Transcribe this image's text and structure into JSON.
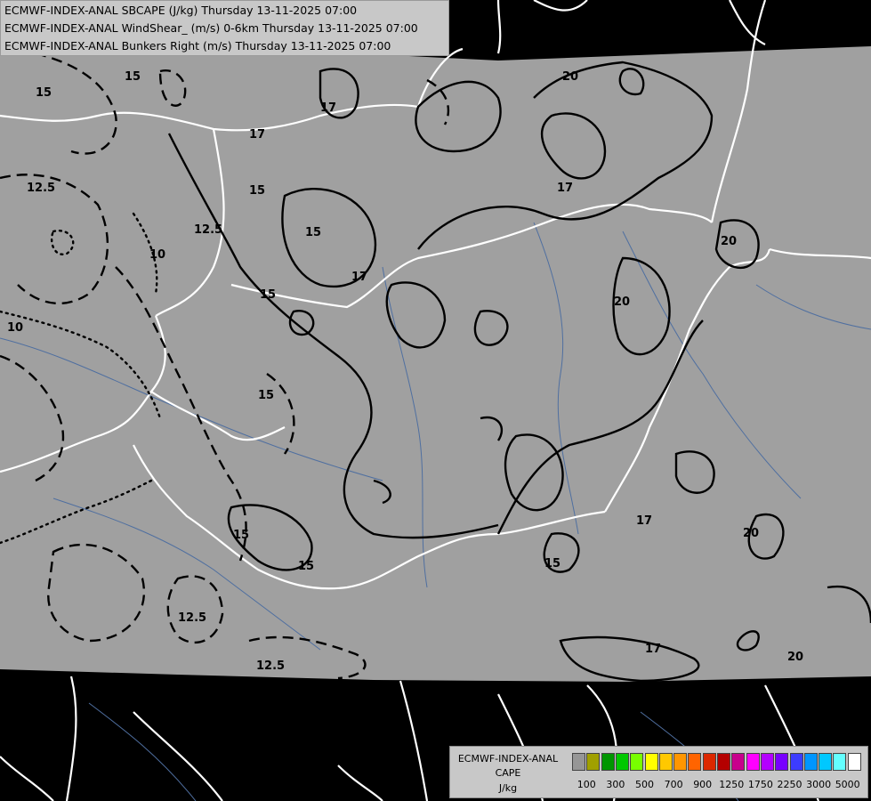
{
  "header": {
    "line1": "ECMWF-INDEX-ANAL SBCAPE (J/kg) Thursday 13-11-2025 07:00",
    "line2": "ECMWF-INDEX-ANAL WindShear_ (m/s) 0-6km Thursday 13-11-2025 07:00",
    "line3": "ECMWF-INDEX-ANAL Bunkers Right (m/s) Thursday 13-11-2025 07:00"
  },
  "legend": {
    "title1": "ECMWF-INDEX-ANAL",
    "title2": "CAPE",
    "unit": "J/kg",
    "ticks": [
      "100",
      "300",
      "500",
      "700",
      "900",
      "1250",
      "1750",
      "2250",
      "3000",
      "5000"
    ],
    "colors": [
      "#969696",
      "#a0a000",
      "#009600",
      "#00c800",
      "#78ff00",
      "#ffff00",
      "#ffc800",
      "#ff9600",
      "#ff6400",
      "#dc2800",
      "#b40000",
      "#c8008c",
      "#ff00ff",
      "#b400ff",
      "#7800ff",
      "#3c3cff",
      "#0096ff",
      "#00c8ff",
      "#64ffff",
      "#ffffff"
    ]
  },
  "map": {
    "background_color": "#000000",
    "domain_fill": "#a0a0a0",
    "contour_labels": {
      "shear_solid": [
        "15",
        "15",
        "15",
        "15",
        "15",
        "15",
        "17",
        "17",
        "17",
        "17",
        "17",
        "17",
        "20",
        "20",
        "20",
        "20",
        "20"
      ],
      "shear_dashed": [
        "15",
        "15",
        "12.5",
        "12.5",
        "12.5",
        "12.5",
        "15"
      ],
      "dotted": [
        "10",
        "10"
      ]
    }
  }
}
